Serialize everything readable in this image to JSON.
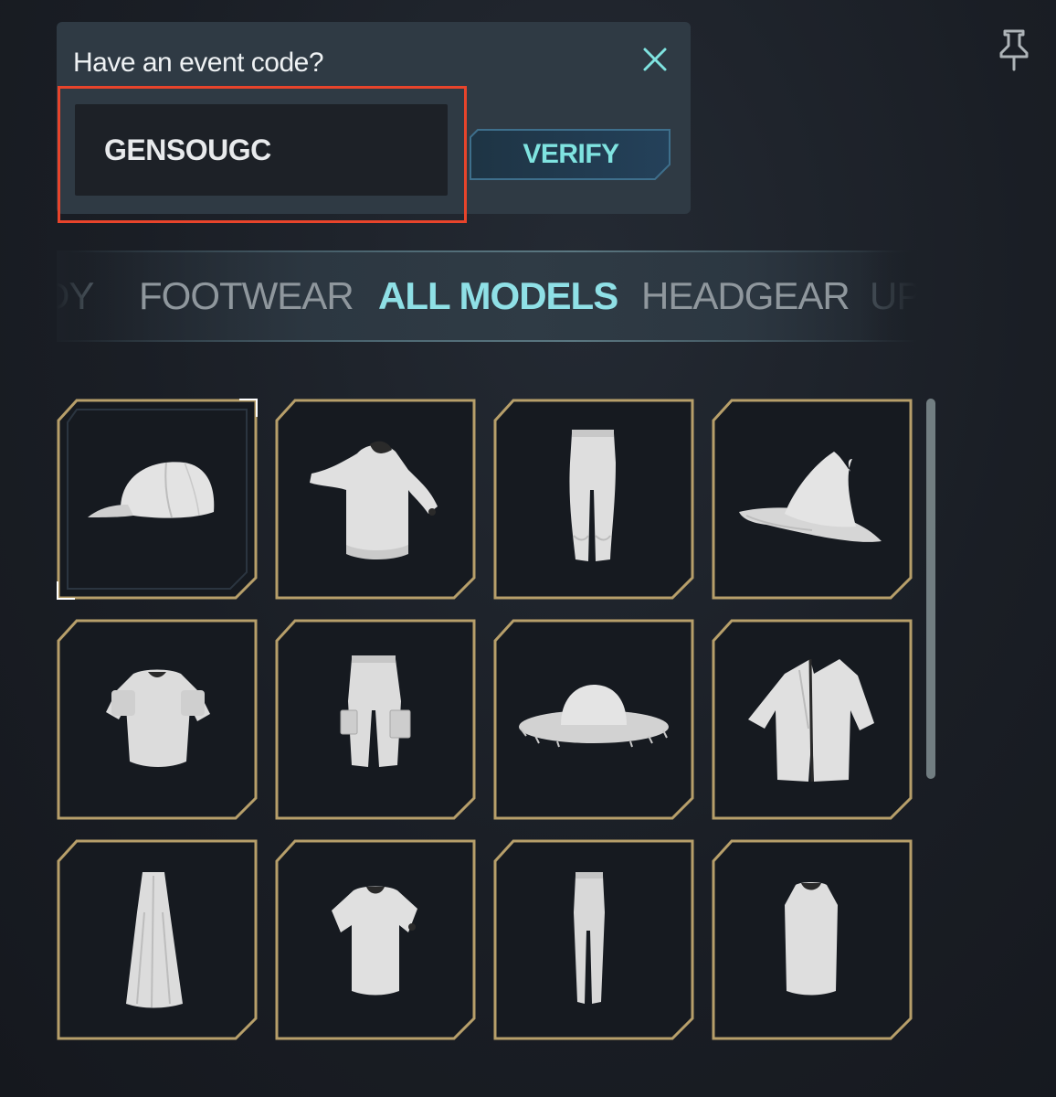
{
  "event_code": {
    "title": "Have an event code?",
    "input_value": "GENSOUGC",
    "verify_label": "VERIFY"
  },
  "tabs": [
    {
      "label": "DY",
      "state": "faded"
    },
    {
      "label": "FOOTWEAR",
      "state": "normal"
    },
    {
      "label": "ALL MODELS",
      "state": "active"
    },
    {
      "label": "HEADGEAR",
      "state": "normal"
    },
    {
      "label": "UP",
      "state": "faded"
    }
  ],
  "items": [
    {
      "icon": "baseball-cap-icon",
      "selected": true
    },
    {
      "icon": "hoodie-icon",
      "selected": false
    },
    {
      "icon": "cargo-pants-icon",
      "selected": false
    },
    {
      "icon": "wizard-hat-icon",
      "selected": false
    },
    {
      "icon": "armored-top-icon",
      "selected": false
    },
    {
      "icon": "pocket-shorts-icon",
      "selected": false
    },
    {
      "icon": "straw-hat-icon",
      "selected": false
    },
    {
      "icon": "open-jacket-icon",
      "selected": false
    },
    {
      "icon": "long-skirt-icon",
      "selected": false
    },
    {
      "icon": "t-shirt-icon",
      "selected": false
    },
    {
      "icon": "slim-pants-icon",
      "selected": false
    },
    {
      "icon": "tank-top-icon",
      "selected": false
    }
  ],
  "colors": {
    "frame_gold": "#b79f6a",
    "active_tab": "#8fe0e6",
    "highlight_red": "#e8442b",
    "panel_bg": "#2f3a44"
  }
}
